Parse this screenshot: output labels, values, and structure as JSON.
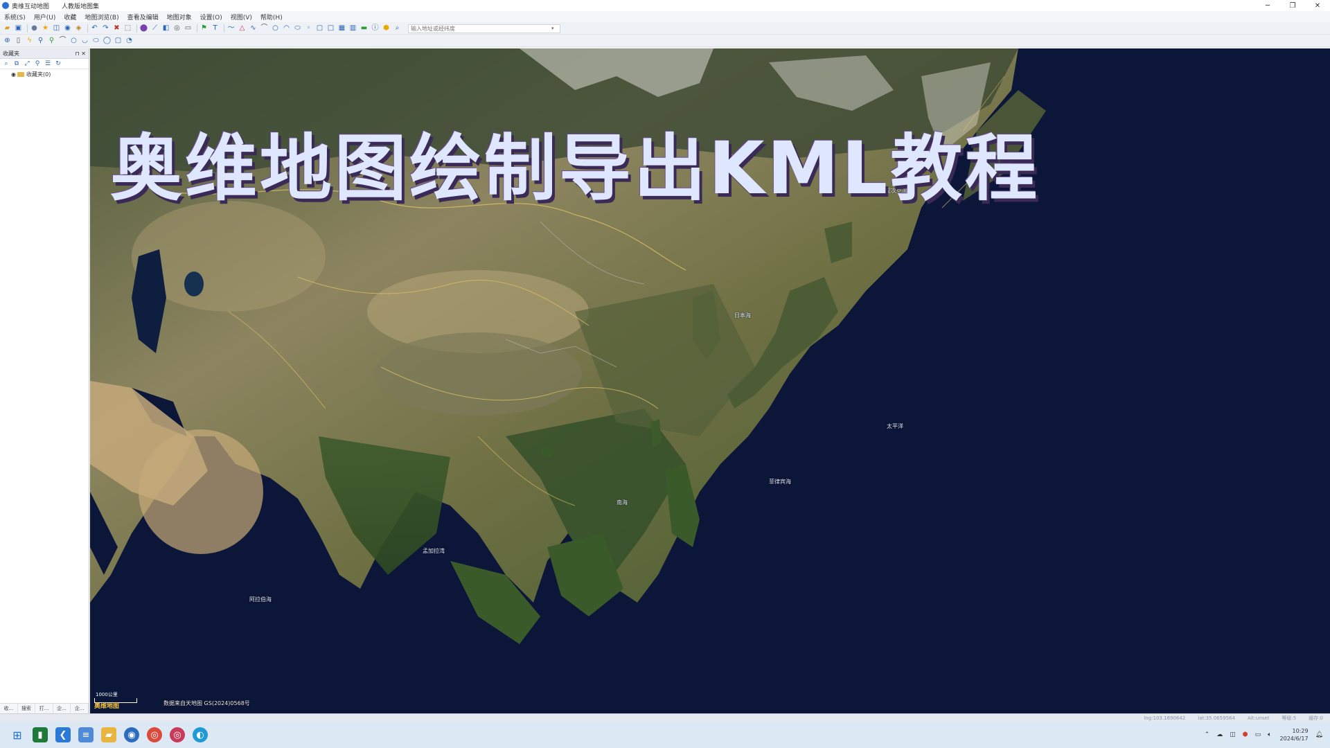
{
  "window": {
    "app_title": "奥维互动地图",
    "doc_title": "人教版地图集",
    "controls": {
      "minimize": "─",
      "restore": "❐",
      "close": "✕"
    }
  },
  "menu": [
    "系统(S)",
    "用户(U)",
    "收藏",
    "地图浏览(B)",
    "查看及编辑",
    "地图对象",
    "设置(O)",
    "视图(V)",
    "帮助(H)"
  ],
  "toolbar": {
    "search_placeholder": "输入地址或经纬度"
  },
  "left_panel": {
    "title": "收藏夹",
    "tree_root": "收藏夹(0)",
    "bottom_tabs": [
      "收...",
      "搜索",
      "打...",
      "企...",
      "企..."
    ]
  },
  "banner": {
    "text": "奥维地图绘制导出KML教程"
  },
  "map": {
    "labels": [
      "太平洋",
      "菲律宾海",
      "南海",
      "孟加拉湾",
      "阿拉伯海",
      "日本海",
      "鄂霍次克海"
    ],
    "credit": "数据来自天地图  GS(2024)0568号",
    "scale_text": "1000公里",
    "logo_text": "奥维地图"
  },
  "status": {
    "lng": "lng:103.1690642",
    "lat": "lat:35.0659564",
    "alt": "Alt:unset",
    "zoom": "等级:5",
    "level": "缓存:0"
  },
  "taskbar": {
    "time": "10:29",
    "date": "2024/6/17",
    "icons": [
      "windows-start",
      "terminal",
      "vscode",
      "notepad",
      "file-explorer",
      "ovital-map",
      "chrome",
      "chrome-profile",
      "edge"
    ]
  },
  "colors": {
    "ocean": "#0b1638",
    "land": "#7a7451",
    "banner_text": "#dfe7ff",
    "banner_shadow": "#3a2a55",
    "taskbar": "#dde8f5"
  }
}
